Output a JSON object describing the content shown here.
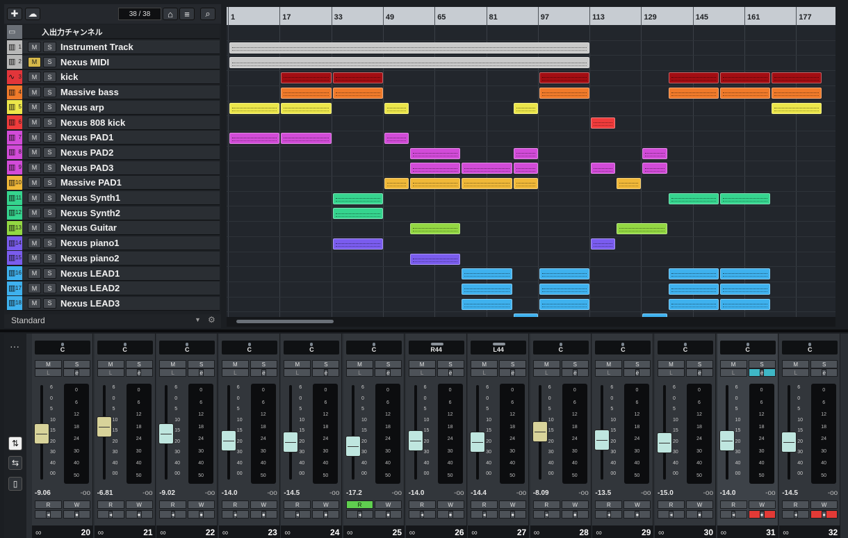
{
  "toolbar": {
    "add_icon": "plus-icon",
    "cloud_icon": "cloud-icon",
    "count": "38 / 38",
    "search_icon": "search-icon"
  },
  "folder_label": "入出力チャンネル",
  "tracks": [
    {
      "n": "1",
      "name": "Instrument Track",
      "color": "#b8b8b8",
      "icon": "piano-icon",
      "m": false,
      "top": 0
    },
    {
      "n": "2",
      "name": "Nexus MIDI",
      "color": "#b8b8b8",
      "icon": "piano-icon",
      "m": true
    },
    {
      "n": "3",
      "name": "kick",
      "color": "#e2353a",
      "icon": "waveform-icon",
      "m": false
    },
    {
      "n": "4",
      "name": "Massive bass",
      "color": "#f07a2a",
      "icon": "piano-icon",
      "m": false
    },
    {
      "n": "5",
      "name": "Nexus arp",
      "color": "#ece64a",
      "icon": "piano-icon",
      "m": false
    },
    {
      "n": "6",
      "name": "Nexus 808 kick",
      "color": "#ef3b3b",
      "icon": "piano-icon",
      "m": false
    },
    {
      "n": "7",
      "name": "Nexus PAD1",
      "color": "#d24bd8",
      "icon": "piano-icon",
      "m": false
    },
    {
      "n": "8",
      "name": "Nexus PAD2",
      "color": "#d24bd8",
      "icon": "piano-icon",
      "m": false
    },
    {
      "n": "9",
      "name": "Nexus PAD3",
      "color": "#d24bd8",
      "icon": "piano-icon",
      "m": false
    },
    {
      "n": "10",
      "name": "Massive PAD1",
      "color": "#f0b838",
      "icon": "piano-icon",
      "m": false
    },
    {
      "n": "11",
      "name": "Nexus Synth1",
      "color": "#35d48e",
      "icon": "piano-icon",
      "m": false
    },
    {
      "n": "12",
      "name": "Nexus Synth2",
      "color": "#35d48e",
      "icon": "piano-icon",
      "m": false
    },
    {
      "n": "13",
      "name": "Nexus Guitar",
      "color": "#93d842",
      "icon": "piano-icon",
      "m": false
    },
    {
      "n": "14",
      "name": "Nexus piano1",
      "color": "#7a5cee",
      "icon": "piano-icon",
      "m": false
    },
    {
      "n": "15",
      "name": "Nexus piano2",
      "color": "#7a5cee",
      "icon": "piano-icon",
      "m": false
    },
    {
      "n": "16",
      "name": "Nexus LEAD1",
      "color": "#3eb1ee",
      "icon": "piano-icon",
      "m": false
    },
    {
      "n": "17",
      "name": "Nexus LEAD2",
      "color": "#3eb1ee",
      "icon": "piano-icon",
      "m": false
    },
    {
      "n": "18",
      "name": "Nexus LEAD3",
      "color": "#3eb1ee",
      "icon": "piano-icon",
      "m": false
    }
  ],
  "footer": {
    "preset": "Standard"
  },
  "ruler": [
    "1",
    "17",
    "33",
    "49",
    "65",
    "81",
    "97",
    "113",
    "129",
    "145",
    "161",
    "177"
  ],
  "mixer": {
    "m_label": "M",
    "s_label": "S",
    "r_label": "R",
    "w_label": "W",
    "fader_scale": [
      "6",
      "0",
      "5",
      "10",
      "15",
      "20",
      "30",
      "40",
      "00"
    ],
    "meter_scale": [
      "0",
      "6",
      "12",
      "18",
      "24",
      "30",
      "40",
      "50"
    ],
    "channels": [
      {
        "num": "20",
        "pan": "C",
        "vol": "-9.06",
        "peak": "-oo",
        "cap": "#d8d39a",
        "level": 0.42
      },
      {
        "num": "21",
        "pan": "C",
        "vol": "-6.81",
        "peak": "-oo",
        "cap": "#d8d39a",
        "level": 0.5
      },
      {
        "num": "22",
        "pan": "C",
        "vol": "-9.02",
        "peak": "-oo",
        "cap": "#bfe6df",
        "level": 0.42
      },
      {
        "num": "23",
        "pan": "C",
        "vol": "-14.0",
        "peak": "-oo",
        "cap": "#bfe6df",
        "level": 0.33
      },
      {
        "num": "24",
        "pan": "C",
        "vol": "-14.5",
        "peak": "-oo",
        "cap": "#bfe6df",
        "level": 0.32
      },
      {
        "num": "25",
        "pan": "C",
        "vol": "-17.2",
        "peak": "-oo",
        "cap": "#bfe6df",
        "level": 0.27,
        "read_on": true
      },
      {
        "num": "26",
        "pan": "R44",
        "vol": "-14.0",
        "peak": "-oo",
        "cap": "#bfe6df",
        "level": 0.33,
        "pan_bar": true
      },
      {
        "num": "27",
        "pan": "L44",
        "vol": "-14.4",
        "peak": "-oo",
        "cap": "#bfe6df",
        "level": 0.32,
        "pan_bar": true
      },
      {
        "num": "28",
        "pan": "C",
        "vol": "-8.09",
        "peak": "-oo",
        "cap": "#d8d39a",
        "level": 0.44
      },
      {
        "num": "29",
        "pan": "C",
        "vol": "-13.5",
        "peak": "-oo",
        "cap": "#bfe6df",
        "level": 0.34
      },
      {
        "num": "30",
        "pan": "C",
        "vol": "-15.0",
        "peak": "-oo",
        "cap": "#bfe6df",
        "level": 0.31
      },
      {
        "num": "31",
        "pan": "C",
        "vol": "-14.0",
        "peak": "-oo",
        "cap": "#bfe6df",
        "level": 0.33,
        "selected": true,
        "e_on": true,
        "rec_on": true
      },
      {
        "num": "32",
        "pan": "C",
        "vol": "-14.5",
        "peak": "-oo",
        "cap": "#bfe6df",
        "level": 0.32,
        "rec_on": true
      }
    ]
  }
}
